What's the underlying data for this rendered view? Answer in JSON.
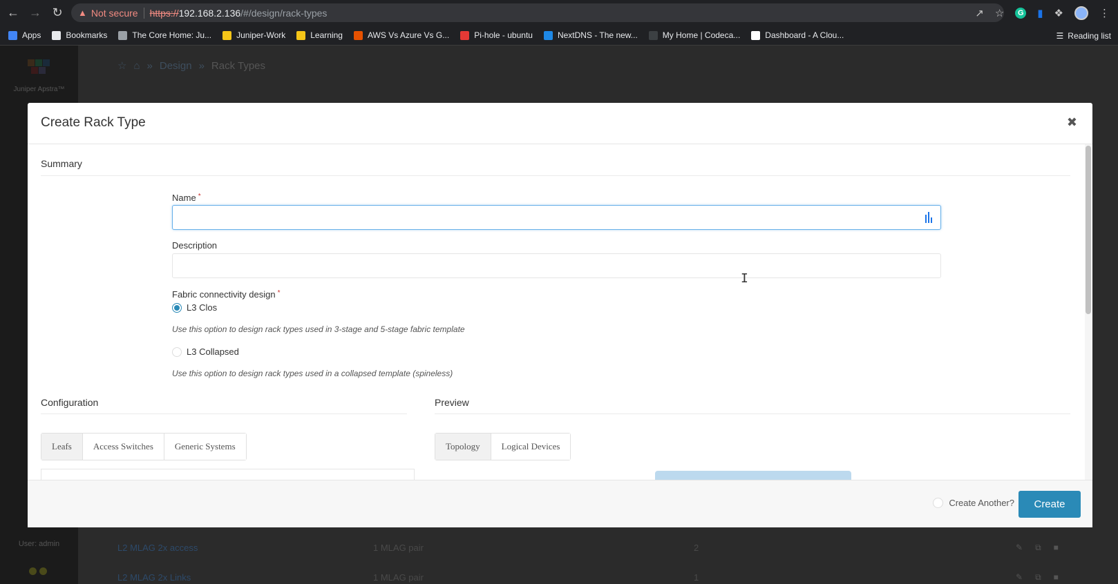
{
  "browser": {
    "not_secure": "Not secure",
    "url_scheme": "https://",
    "url_host": "192.168.2.136",
    "url_path": "/#/design/rack-types",
    "reading_list": "Reading list",
    "bookmarks": [
      {
        "label": "Apps",
        "color": "#4285f4"
      },
      {
        "label": "Bookmarks",
        "color": "#e8eaed"
      },
      {
        "label": "The Core Home: Ju...",
        "color": "#9aa0a6"
      },
      {
        "label": "Juniper-Work",
        "color": "#f5c518"
      },
      {
        "label": "Learning",
        "color": "#f5c518"
      },
      {
        "label": "AWS Vs Azure Vs G...",
        "color": "#e65100"
      },
      {
        "label": "Pi-hole - ubuntu",
        "color": "#e53935"
      },
      {
        "label": "NextDNS - The new...",
        "color": "#1e88e5"
      },
      {
        "label": "My Home | Codeca...",
        "color": "#3c4043"
      },
      {
        "label": "Dashboard - A Clou...",
        "color": "#ffffff"
      }
    ]
  },
  "app": {
    "name": "Juniper Apstra™",
    "user": "User: admin",
    "breadcrumb": {
      "design": "Design",
      "current": "Rack Types"
    },
    "rows": [
      {
        "name": "L2 MLAG 2x access",
        "leafs": "1 MLAG pair",
        "count": "2"
      },
      {
        "name": "L2 MLAG 2x Links",
        "leafs": "1 MLAG pair",
        "count": "1"
      }
    ]
  },
  "modal": {
    "title": "Create Rack Type",
    "summary_title": "Summary",
    "name_label": "Name",
    "name_value": "",
    "description_label": "Description",
    "description_value": "",
    "fabric_label": "Fabric connectivity design",
    "options": [
      {
        "label": "L3 Clos",
        "help": "Use this option to design rack types used in 3-stage and 5-stage fabric template",
        "checked": true
      },
      {
        "label": "L3 Collapsed",
        "help": "Use this option to design rack types used in a collapsed template (spineless)",
        "checked": false
      }
    ],
    "configuration_title": "Configuration",
    "config_tabs": [
      "Leafs",
      "Access Switches",
      "Generic Systems"
    ],
    "preview_title": "Preview",
    "preview_tabs": [
      "Topology",
      "Logical Devices"
    ],
    "create_another": "Create Another?",
    "create_button": "Create"
  },
  "colors": {
    "accent": "#2a8ab7",
    "required": "#c9302c"
  }
}
